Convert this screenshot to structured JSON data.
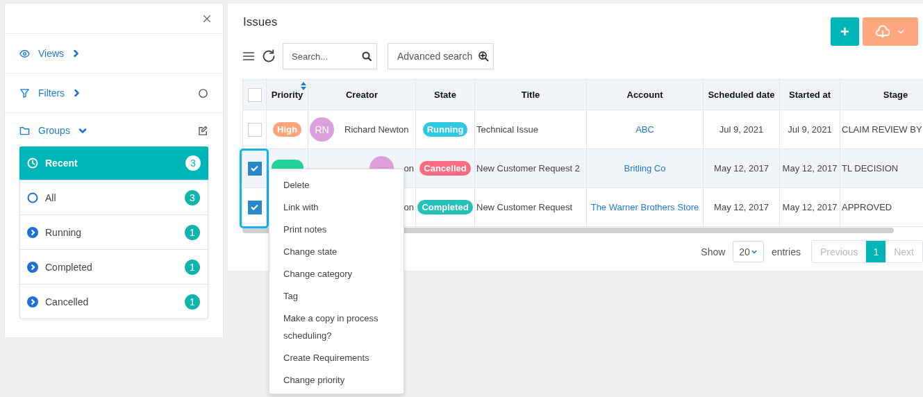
{
  "sidebar": {
    "sections": [
      {
        "label": "Views",
        "kind": "views",
        "expanded": false
      },
      {
        "label": "Filters",
        "kind": "filters",
        "expanded": false
      },
      {
        "label": "Groups",
        "kind": "groups",
        "expanded": true
      }
    ],
    "groups": [
      {
        "label": "Recent",
        "count": "3",
        "kind": "recent",
        "selected": true
      },
      {
        "label": "All",
        "count": "3",
        "kind": "all",
        "selected": false
      },
      {
        "label": "Running",
        "count": "1",
        "kind": "status",
        "selected": false
      },
      {
        "label": "Completed",
        "count": "1",
        "kind": "status",
        "selected": false
      },
      {
        "label": "Cancelled",
        "count": "1",
        "kind": "status",
        "selected": false
      }
    ]
  },
  "main": {
    "title": "Issues",
    "search": {
      "placeholder": "Search..."
    },
    "advanced_search": "Advanced search",
    "add_button": "+",
    "table": {
      "header_checked": false,
      "columns": [
        "Priority",
        "Creator",
        "State",
        "Title",
        "Account",
        "Scheduled date",
        "Started at",
        "Stage"
      ],
      "rows": [
        {
          "checked": false,
          "priority": {
            "label": "High",
            "color": "#ffa37a"
          },
          "avatar": {
            "initials": "RN"
          },
          "creator": "Richard Newton",
          "state": {
            "label": "Running",
            "color": "#2ec9e0"
          },
          "title": "Technical Issue",
          "account": "ABC",
          "scheduled": "Jul 9, 2021",
          "started": "Jul 9, 2021",
          "stage": "CLAIM REVIEW BY"
        },
        {
          "checked": true,
          "priority": {
            "color": "#20d39a"
          },
          "avatar": {},
          "creator": "on",
          "state": {
            "label": "Cancelled",
            "color": "#fb6b7f"
          },
          "title": "New Customer Request 2",
          "account": "Britling Co",
          "scheduled": "May 12, 2017",
          "started": "May 12, 2017",
          "stage": "TL DECISION"
        },
        {
          "checked": true,
          "creator": "on",
          "state": {
            "label": "Completed",
            "color": "#26c1b8"
          },
          "title": "New Customer Request",
          "account": "The Warner Brothers Store",
          "scheduled": "May 12, 2017",
          "started": "May 12, 2017",
          "stage": "APPROVED"
        }
      ]
    },
    "pagination": {
      "show": "Show",
      "page_size": "20",
      "entries": "entries",
      "previous": "Previous",
      "pages": [
        {
          "label": "1",
          "selected": true
        }
      ],
      "next": "Next"
    }
  },
  "context_menu": [
    "Delete",
    "Link with",
    "Print notes",
    "Change state",
    "Change category",
    "Tag",
    "Make a copy in process scheduling?",
    "Create Requirements",
    "Change priority"
  ]
}
